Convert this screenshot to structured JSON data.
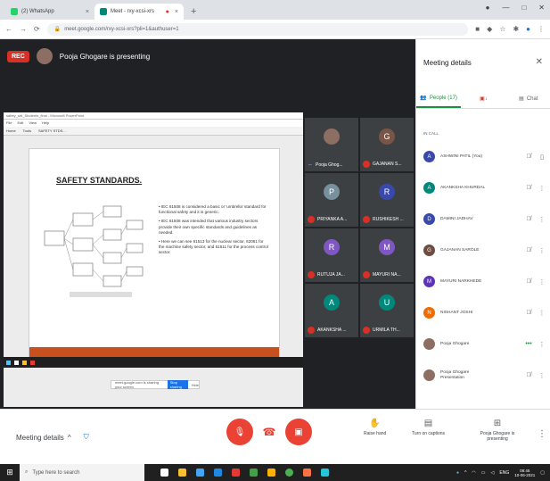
{
  "browser": {
    "tabs": [
      {
        "label": "(2) WhatsApp",
        "active": false,
        "color": "#25d366"
      },
      {
        "label": "Meet - rxy-xcsi-xrs",
        "active": true,
        "color": "#00897b"
      }
    ],
    "url": "meet.google.com/rxy-xcsi-xrs?pli=1&authuser=1"
  },
  "meeting": {
    "rec_label": "REC",
    "presenting_text": "Pooja Ghogare is presenting"
  },
  "shared_window": {
    "title_bar": "safety_std_Students_final - Microsoft PowerPoint",
    "menu": [
      "File",
      "Edit",
      "View",
      "Help"
    ],
    "tabs": [
      "Home",
      "Tools",
      "SAFETY STDS..."
    ]
  },
  "slide": {
    "title": "SAFETY STANDARDS.",
    "bullets": [
      "• IEC 61508 is considered a basic or 'umbrella' standard for functional safety and it is generic.",
      "• IEC 61508 was intended that various industry sectors provide their own specific standards and guidelines as needed.",
      "• Here we can see 61513 for the nuclear sector, 62061 for the machine safety sector, and 61511 for the process control sector."
    ]
  },
  "share_banner": {
    "text": "meet.google.com is sharing your screen.",
    "stop_label": "Stop sharing",
    "hide_label": "Hide"
  },
  "tiles": [
    {
      "initial": "",
      "name": "Pooja Ghog...",
      "color": "#8d6e63",
      "muted": false
    },
    {
      "initial": "G",
      "name": "GAJANAN S...",
      "color": "#795548",
      "muted": true
    },
    {
      "initial": "P",
      "name": "PRIYANKA A...",
      "color": "#78909c",
      "muted": true
    },
    {
      "initial": "R",
      "name": "RUSHIKESH ...",
      "color": "#3949ab",
      "muted": true
    },
    {
      "initial": "R",
      "name": "RUTUJA JA...",
      "color": "#7e57c2",
      "muted": true
    },
    {
      "initial": "M",
      "name": "MAYURI NA...",
      "color": "#7e57c2",
      "muted": true
    },
    {
      "initial": "A",
      "name": "AKANKSHA ...",
      "color": "#00897b",
      "muted": true
    },
    {
      "initial": "U",
      "name": "URMILA TH...",
      "color": "#00897b",
      "muted": true
    }
  ],
  "panel": {
    "title": "Meeting details",
    "tabs": {
      "people": "People (17)",
      "chat": "Chat"
    },
    "section_label": "IN CALL",
    "people": [
      {
        "initial": "A",
        "name": "ASHWINI PATIL (You)",
        "color": "#3949ab"
      },
      {
        "initial": "A",
        "name": "AKANKSHA KHURDAL",
        "color": "#00897b"
      },
      {
        "initial": "D",
        "name": "DAMINI JADHAV",
        "color": "#3949ab"
      },
      {
        "initial": "G",
        "name": "GAJANAN SAROLE",
        "color": "#6d4c41"
      },
      {
        "initial": "M",
        "name": "MAYURI NARKHEDE",
        "color": "#5e35b1"
      },
      {
        "initial": "N",
        "name": "NISHANT JOSHI",
        "color": "#ef6c00"
      },
      {
        "initial": "",
        "name": "Pooja Ghogare",
        "color": "#8d6e63"
      },
      {
        "initial": "",
        "name": "Pooja Ghogare\nPresentation",
        "color": "#8d6e63"
      }
    ]
  },
  "controls": {
    "meeting_details": "Meeting details",
    "raise_hand": "Raise hand",
    "captions": "Turn on captions",
    "presenting": "Pooja Ghogare is presenting"
  },
  "taskbar": {
    "search_placeholder": "Type here to search",
    "time": "08:45",
    "date": "10-06-2021",
    "lang": "ENG"
  }
}
